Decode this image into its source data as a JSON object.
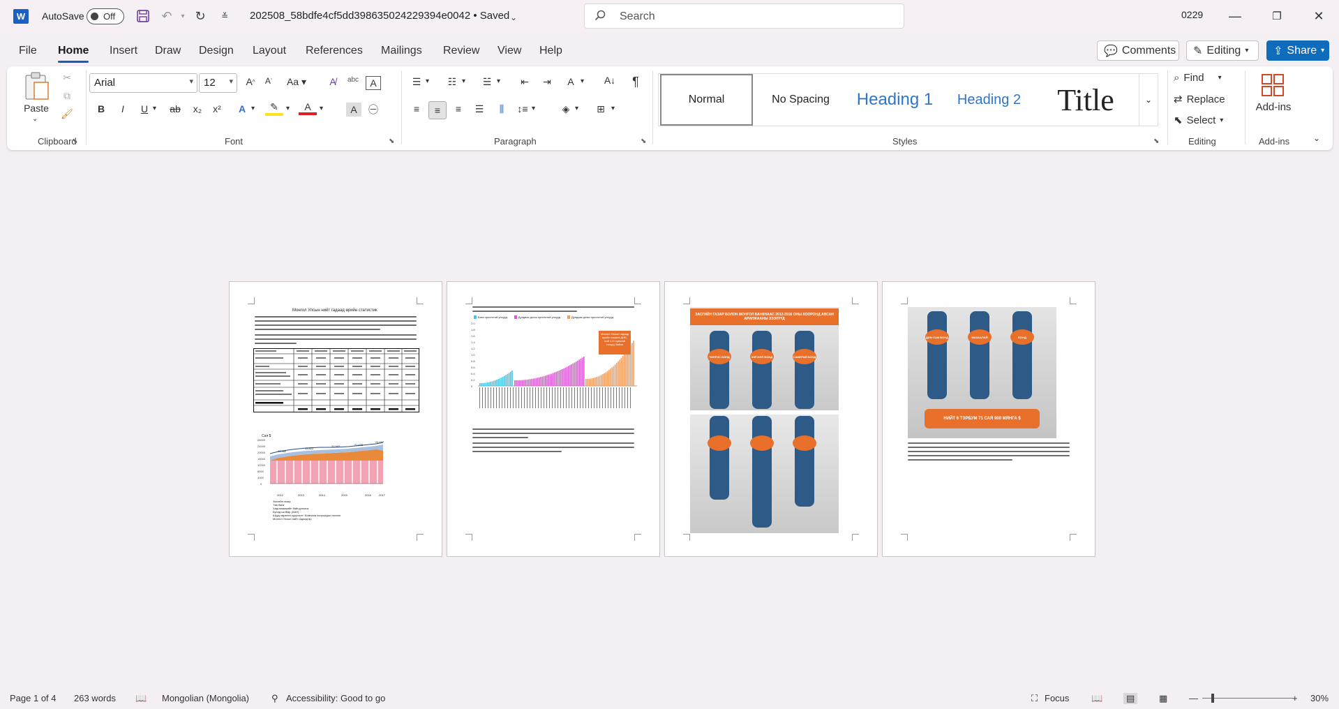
{
  "titlebar": {
    "autosave_label": "AutoSave",
    "autosave_state": "Off",
    "document_title": "202508_58bdfe4cf5dd398635024229394e0042 • Saved",
    "search_placeholder": "Search",
    "user": "0229"
  },
  "menu": {
    "tabs": [
      "File",
      "Home",
      "Insert",
      "Draw",
      "Design",
      "Layout",
      "References",
      "Mailings",
      "Review",
      "View",
      "Help"
    ],
    "active": "Home",
    "comments_label": "Comments",
    "editing_label": "Editing",
    "share_label": "Share"
  },
  "ribbon": {
    "clipboard": {
      "paste_label": "Paste",
      "group": "Clipboard"
    },
    "font": {
      "family": "Arial",
      "size": "12",
      "group": "Font"
    },
    "paragraph": {
      "group": "Paragraph"
    },
    "styles": {
      "group": "Styles",
      "items": [
        "Normal",
        "No Spacing",
        "Heading 1",
        "Heading 2",
        "Title"
      ]
    },
    "editing": {
      "find": "Find",
      "replace": "Replace",
      "select": "Select",
      "group": "Editing"
    },
    "addins": {
      "label": "Add-ins",
      "group": "Add-ins"
    }
  },
  "pages": {
    "p1": {
      "heading": "Монгол Улсын нийт гадаад өрийн статистик",
      "chart_ylabel": "Сая $",
      "chart_labels": [
        "19,380",
        "19,822",
        "20,942",
        "21,628",
        "24,637"
      ],
      "chart_x": [
        "2012",
        "2013",
        "2014",
        "2015",
        "2016",
        "2017"
      ],
      "legend": [
        "Засгийн газар",
        "Төв банк",
        "Хадгаламжийн байгууллага",
        "Бусад салбар (ААН)",
        "Шууд хөрөнгө оруулалт: Компани хоорондын зээлэл",
        "Монгол Улсын нийт гадаад өр"
      ]
    },
    "p2": {
      "chart_legend": [
        "Бага орлоготой улсууд",
        "Дундаас доош орлоготой улсууд",
        "Дундаас дээш орлоготой улсууд"
      ],
      "callout": "Монгол Улсын гадаад өрийн хэмжээ ДНБ-ний 173 хувьтай тэнцүү байна"
    },
    "p3": {
      "banner": "ЗАСГИЙН ГАЗАР БОЛОН МОНГОЛ БАНКНААС 2012-2016 ОНЫ ХООРОНД АВСАН АРИЛЖААНЫ ЗЭЭЛҮҮД",
      "bonds": [
        "ЧИНГИС БОНД",
        "ХӨГЖИЛ БОНД",
        "САМУРАЙ БОНД"
      ]
    },
    "p4": {
      "bonds": [
        "ДИМ САМ БОНД",
        "МАЗААЛАЙ",
        "БОНД"
      ],
      "banner": "НИЙТ 6 ТЭРБУМ 71 САЯ 900 МЯНГА $"
    }
  },
  "status": {
    "page": "Page 1 of 4",
    "words": "263 words",
    "language": "Mongolian (Mongolia)",
    "accessibility": "Accessibility: Good to go",
    "focus": "Focus",
    "zoom": "30%"
  },
  "colors": {
    "accent": "#185abd",
    "share": "#0f6cbd",
    "word_logo": "#1a5fc1",
    "orange": "#e8702a",
    "navy": "#2d5a87"
  }
}
